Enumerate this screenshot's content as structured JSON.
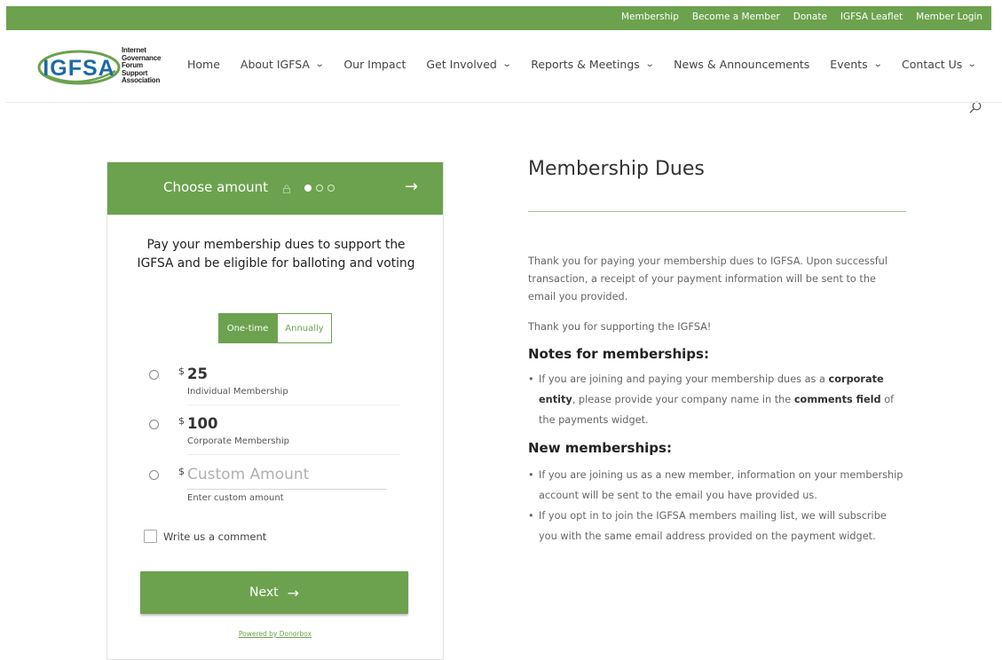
{
  "topbar": {
    "links": [
      "Membership",
      "Become a Member",
      "Donate",
      "IGFSA Leaflet",
      "Member Login"
    ]
  },
  "logo": {
    "mark": "IGFSA",
    "tagline": [
      "Internet",
      "Governance",
      "Forum",
      "Support",
      "Association"
    ]
  },
  "nav": {
    "items": [
      {
        "label": "Home",
        "dropdown": false
      },
      {
        "label": "About IGFSA",
        "dropdown": true
      },
      {
        "label": "Our Impact",
        "dropdown": false
      },
      {
        "label": "Get Involved",
        "dropdown": true
      },
      {
        "label": "Reports & Meetings",
        "dropdown": true
      },
      {
        "label": "News & Announcements",
        "dropdown": false
      },
      {
        "label": "Events",
        "dropdown": true
      },
      {
        "label": "Contact Us",
        "dropdown": true
      }
    ],
    "search_icon": "search-icon"
  },
  "widget": {
    "header_title": "Choose amount",
    "header_arrow": "→",
    "step_current": 1,
    "step_total": 3,
    "intro": "Pay your membership dues to support the IGFSA and be eligible for balloting and voting",
    "frequency": {
      "one_time": "One-time",
      "annually": "Annually",
      "selected": "One-time"
    },
    "currency_symbol": "$",
    "amounts": [
      {
        "value": "25",
        "label": "Individual Membership"
      },
      {
        "value": "100",
        "label": "Corporate Membership"
      }
    ],
    "custom": {
      "placeholder": "Custom Amount",
      "label": "Enter custom amount"
    },
    "comment_label": "Write us a comment",
    "next_label": "Next",
    "next_arrow": "→",
    "powered_by": "Powered by Donorbox"
  },
  "content": {
    "title": "Membership Dues",
    "para1": "Thank you for paying your membership dues to IGFSA.  Upon successful transaction, a receipt of your payment information will be sent to the email you provided.",
    "para2": "Thank you for supporting the IGFSA!",
    "notes_heading": "Notes for memberships:",
    "notes_item": {
      "part1": "If you are joining and paying your membership dues as a ",
      "bold1": "corporate entity",
      "part2": ", please provide your company name in the ",
      "bold2": "comments field",
      "part3": " of the payments widget."
    },
    "new_heading": "New memberships:",
    "new_items": [
      "If you are joining us as a new member, information on your membership account will be sent to the email you have provided us.",
      "If you opt in to join the IGFSA members mailing list, we will subscribe you with the same email address provided on the payment widget."
    ]
  },
  "colors": {
    "brand_green": "#6ca24e",
    "logo_blue": "#1e6aa6"
  }
}
